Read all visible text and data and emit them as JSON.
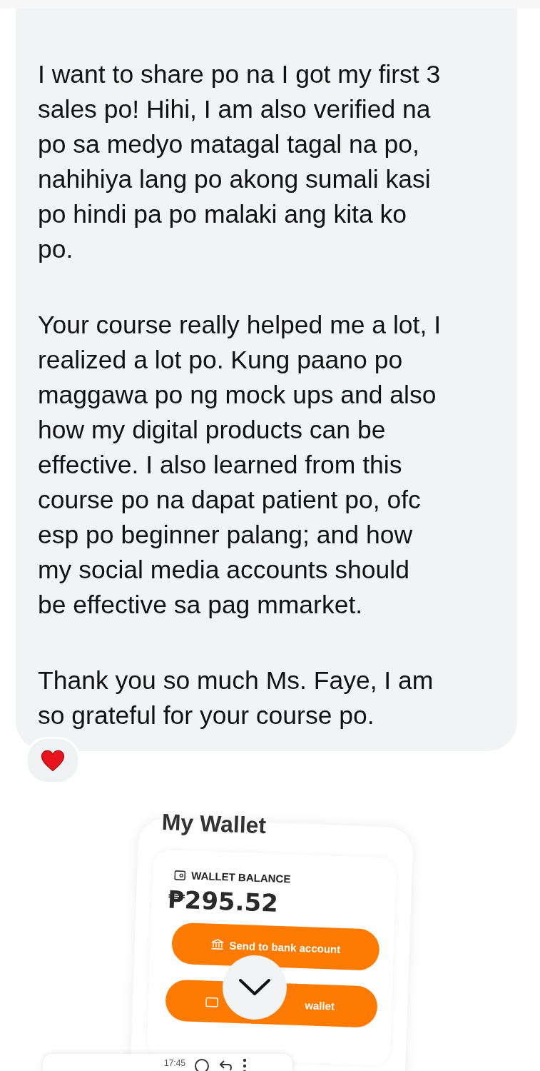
{
  "message": {
    "paragraphs": [
      "I want to share po na I got my first 3\nsales po! Hihi, I am also verified na\npo sa medyo matagal tagal na po,\nnahihiya lang po akong sumali kasi\npo hindi pa po malaki ang kita ko\npo.",
      "Your course really helped me a lot, I\nrealized a lot po. Kung paano po\nmaggawa po ng mock ups and also\nhow my digital products can be\neffective. I also learned from this\ncourse po na dapat patient po, ofc\nesp po beginner palang; and how\nmy social media accounts should\nbe effective sa pag mmarket.",
      "Thank you so much Ms. Faye, I am\nso grateful for your course po."
    ]
  },
  "wallet_screenshot": {
    "title": "My Wallet",
    "balance_label": "WALLET BALANCE",
    "balance": "₱295.52",
    "buttons": [
      {
        "label": "Send to bank account",
        "kind": "bank"
      },
      {
        "label": "wallet",
        "kind": "wallet"
      }
    ]
  },
  "notification": {
    "time": "17:45"
  }
}
